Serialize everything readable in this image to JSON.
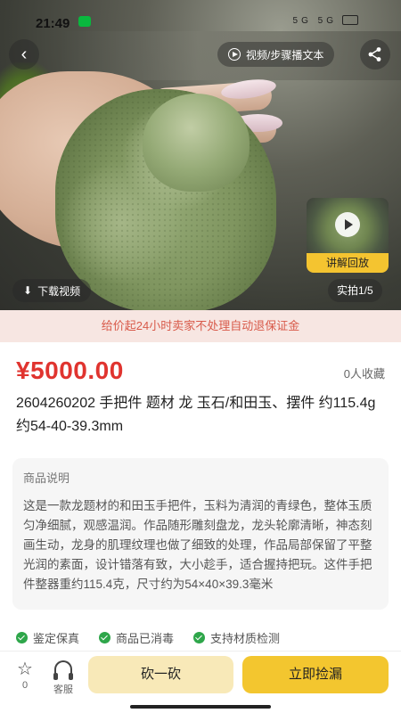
{
  "status_bar": {
    "time": "21:49",
    "signal_text": "5G 5G"
  },
  "hero": {
    "video_pill_label": "视频/步骤播文本",
    "thumbnail_label": "讲解回放",
    "download_label": "下载视频",
    "page_indicator": "实拍1/5"
  },
  "banner": {
    "text": "给价起24小时卖家不处理自动退保证金"
  },
  "product": {
    "price": "¥5000.00",
    "favorites": "0人收藏",
    "title": "2604260202 手把件 题材 龙 玉石/和田玉、摆件 约115.4g 约54-40-39.3mm"
  },
  "description": {
    "heading": "商品说明",
    "body": "这是一款龙题材的和田玉手把件，玉料为清润的青绿色，整体玉质匀净细腻，观感温润。作品随形雕刻盘龙，龙头轮廓清晰，神态刻画生动，龙身的肌理纹理也做了细致的处理，作品局部保留了平整光润的素面，设计错落有致，大小趁手，适合握持把玩。这件手把件整器重约115.4克，尺寸约为54×40×39.3毫米"
  },
  "guarantees": [
    "鉴定保真",
    "商品已消毒",
    "支持材质检测"
  ],
  "bottom_bar": {
    "fav_count": "0",
    "service_label": "客服",
    "bargain_label": "砍一砍",
    "buy_label": "立即捡漏"
  },
  "colors": {
    "price_red": "#e0342f",
    "buy_yellow": "#f3c62f",
    "bargain_yellow": "#f8e9b8",
    "check_green": "#2ea64a"
  }
}
